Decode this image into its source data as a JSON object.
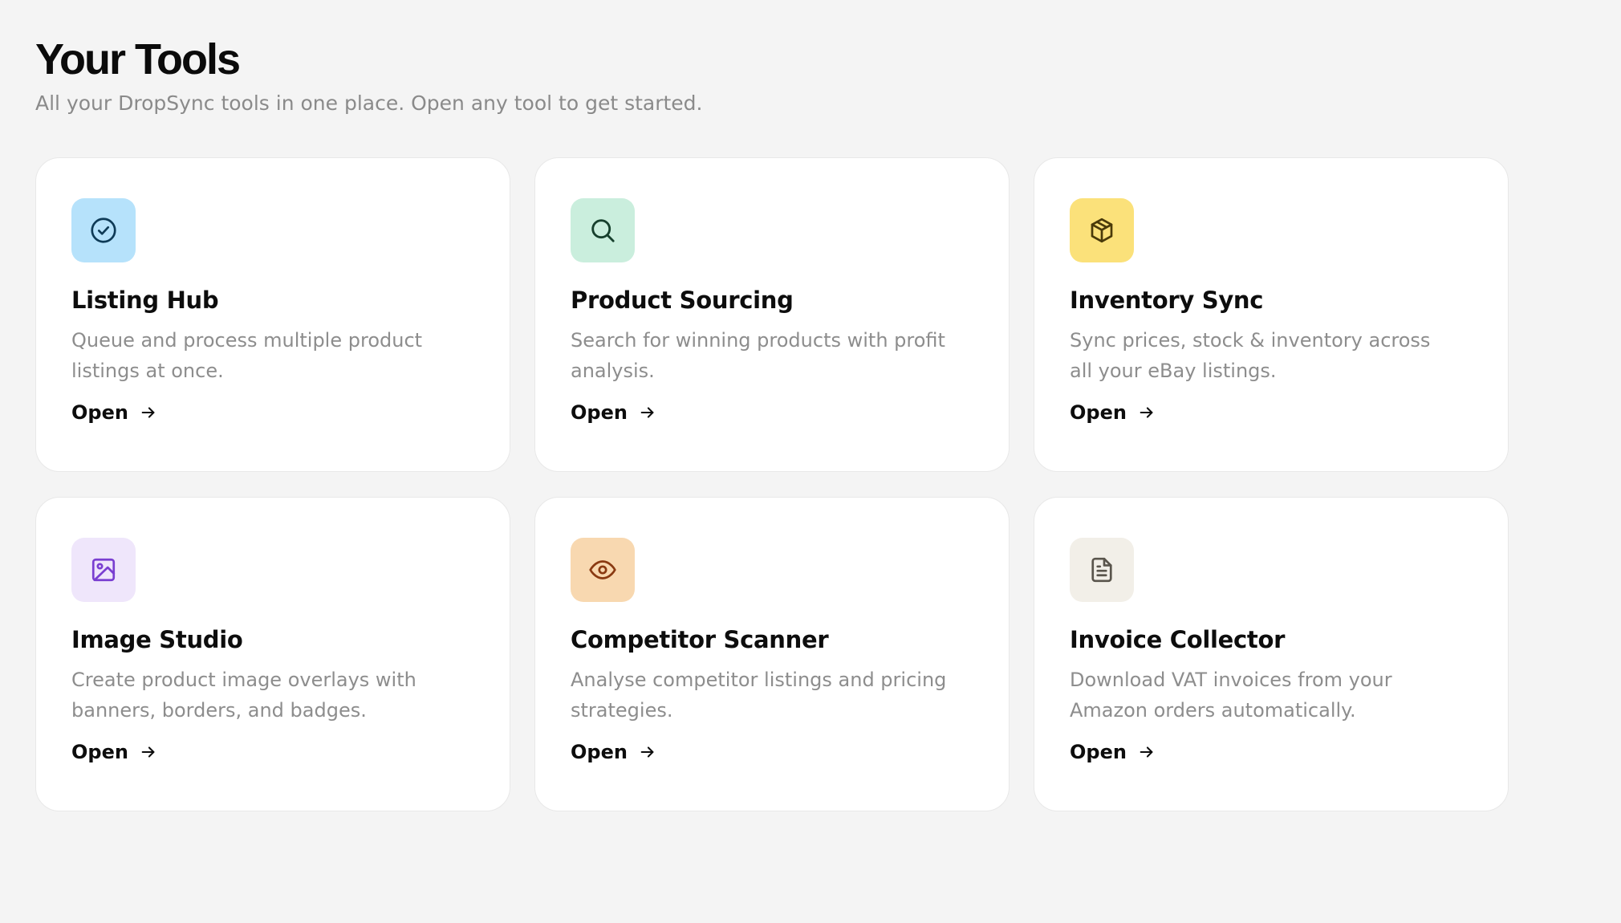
{
  "header": {
    "title": "Your Tools",
    "subtitle": "All your DropSync tools in one place. Open any tool to get started."
  },
  "tools": [
    {
      "name": "Listing Hub",
      "description": "Queue and process multiple product listings at once.",
      "action_label": "Open",
      "icon": "check-circle-icon",
      "tile_color": "#b6e2fb",
      "icon_color": "#0f3b57"
    },
    {
      "name": "Product Sourcing",
      "description": "Search for winning products with profit analysis.",
      "action_label": "Open",
      "icon": "search-icon",
      "tile_color": "#caeedd",
      "icon_color": "#17402d"
    },
    {
      "name": "Inventory Sync",
      "description": "Sync prices, stock & inventory across all your eBay listings.",
      "action_label": "Open",
      "icon": "package-icon",
      "tile_color": "#fbe17a",
      "icon_color": "#4a3a0a"
    },
    {
      "name": "Image Studio",
      "description": "Create product image overlays with banners, borders, and badges.",
      "action_label": "Open",
      "icon": "image-icon",
      "tile_color": "#efe6fb",
      "icon_color": "#7a3fd1"
    },
    {
      "name": "Competitor Scanner",
      "description": "Analyse competitor listings and pricing strategies.",
      "action_label": "Open",
      "icon": "eye-icon",
      "tile_color": "#f8d8b0",
      "icon_color": "#8a3a12"
    },
    {
      "name": "Invoice Collector",
      "description": "Download VAT invoices from your Amazon orders automatically.",
      "action_label": "Open",
      "icon": "document-icon",
      "tile_color": "#f2efe8",
      "icon_color": "#5a554c"
    }
  ]
}
